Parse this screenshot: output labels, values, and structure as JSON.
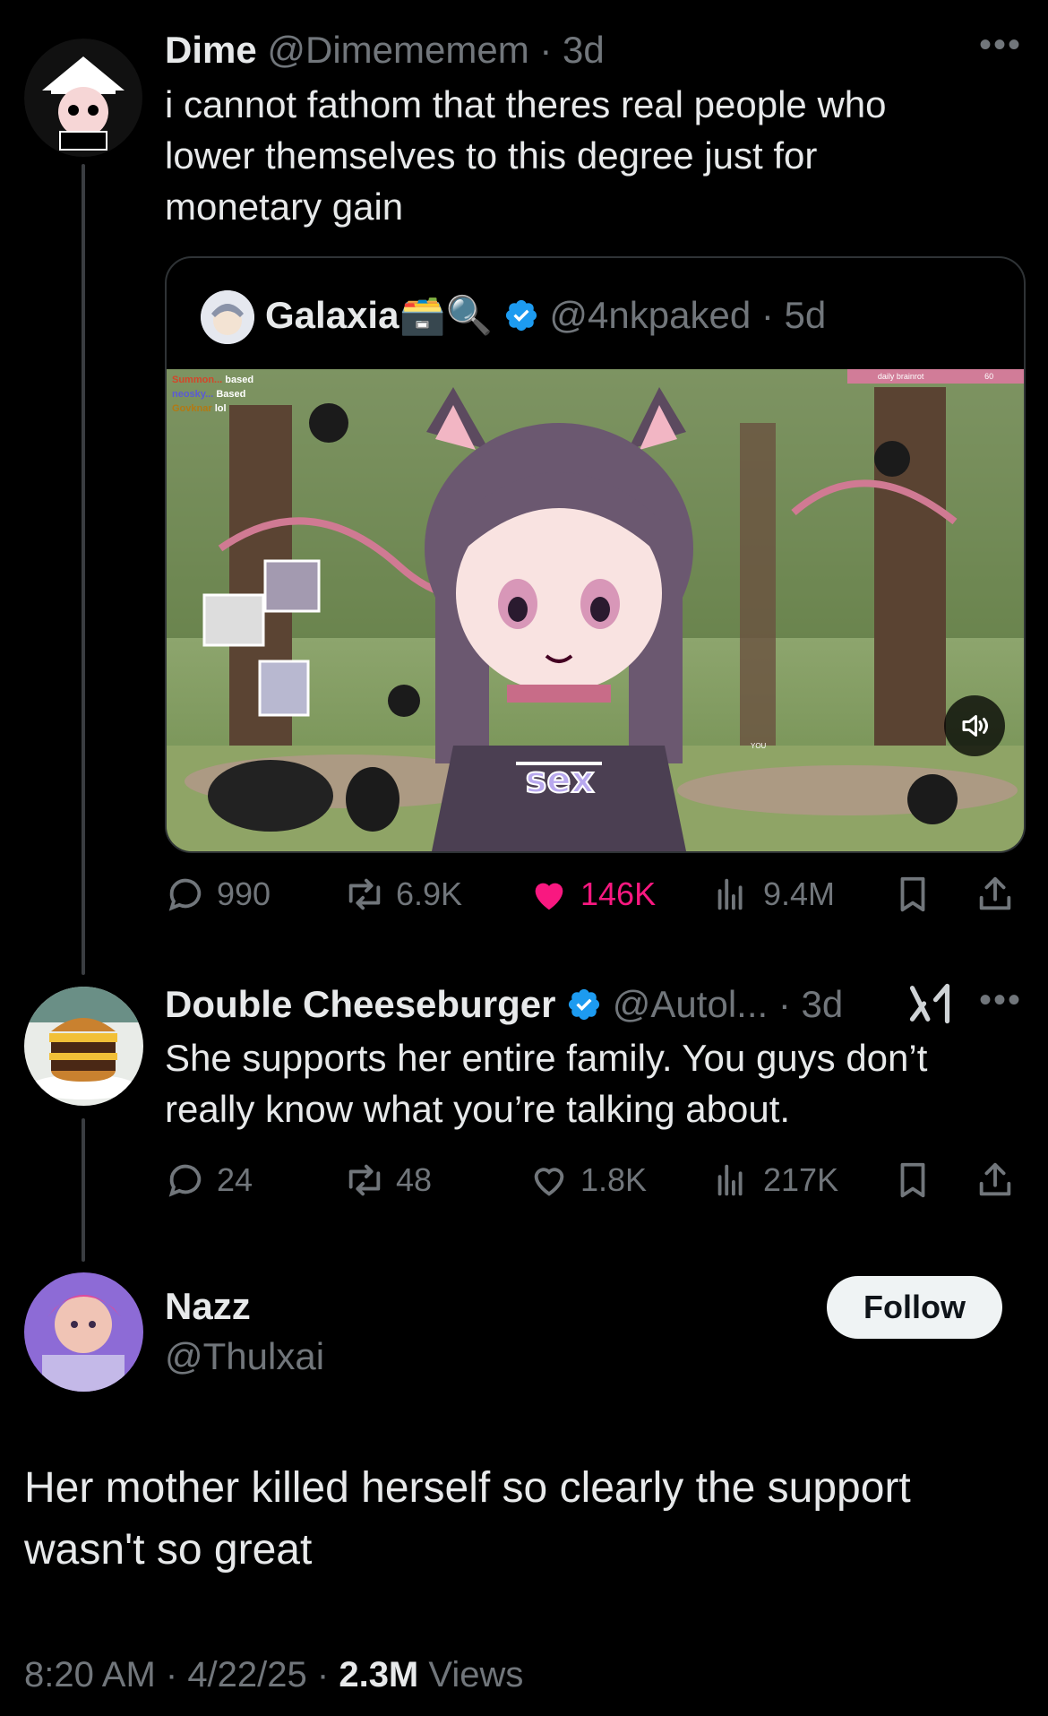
{
  "tweet1": {
    "name": "Dime",
    "handle": "@Dimememem",
    "time": "3d",
    "text_lines": [
      "i cannot fathom that theres real people who",
      "lower themselves to this degree just for",
      "monetary gain"
    ],
    "more": "•••"
  },
  "quote": {
    "name": "Galaxia",
    "emoji": "🗃️🔍",
    "handle": "@4nkpaked",
    "time": "5d",
    "video_overlay": {
      "chat": [
        {
          "user": "Summon...",
          "msg": "based"
        },
        {
          "user": "neosky...",
          "msg": "Based"
        },
        {
          "user": "Govknar",
          "msg": "lol"
        }
      ],
      "top_right_label": "daily brainrot",
      "top_right_count": "60",
      "shirt_text": "sex",
      "you_label": "YOU"
    },
    "mute_icon": "speaker-icon"
  },
  "tweet1_actions": {
    "replies": "990",
    "reposts": "6.9K",
    "likes": "146K",
    "views": "9.4M",
    "like_color": "#f91880"
  },
  "tweet2": {
    "name": "Double Cheeseburger",
    "handle": "@Autol...",
    "time": "3d",
    "text_lines": [
      "She supports her entire family. You guys don’t",
      "really know what you’re talking about."
    ],
    "more": "•••",
    "brand_icon": "grok-icon"
  },
  "tweet2_actions": {
    "replies": "24",
    "reposts": "48",
    "likes": "1.8K",
    "views": "217K"
  },
  "tweet3": {
    "name": "Nazz",
    "handle": "@Thulxai",
    "follow_label": "Follow",
    "text_lines": [
      "Her mother killed herself so clearly the support",
      "wasn't so great"
    ],
    "time": "8:20 AM",
    "date": "4/22/25",
    "views_count": "2.3M",
    "views_label": "Views"
  },
  "colors": {
    "background": "#000000",
    "text": "#e7e9ea",
    "muted": "#71767b",
    "verified": "#1d9bf0",
    "like": "#f91880"
  }
}
